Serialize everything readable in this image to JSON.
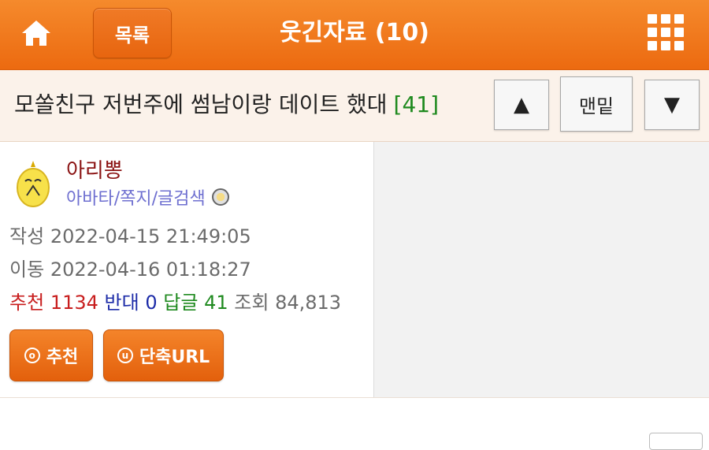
{
  "header": {
    "list_label": "목록",
    "title": "웃긴자료 (10)",
    "icons": [
      "home-icon",
      "grid-menu-icon"
    ],
    "accent_color": "#ee7418"
  },
  "post": {
    "title": "모쏠친구 저번주에 썸남이랑 데이트 했대",
    "comment_count": "[41]"
  },
  "nav": {
    "up_icon": "▲",
    "bottom_label": "맨밑",
    "down_icon": "▼"
  },
  "author": {
    "nickname": "아리뽕",
    "links": "아바타/쪽지/글검색"
  },
  "meta": {
    "written_label": "작성",
    "written_at": "2022-04-15 21:49:05",
    "moved_label": "이동",
    "moved_at": "2022-04-16 01:18:27"
  },
  "stats": {
    "recommend_label": "추천",
    "recommend": "1134",
    "oppose_label": "반대",
    "oppose": "0",
    "reply_label": "답글",
    "reply": "41",
    "views_label": "조회",
    "views": "84,813"
  },
  "actions": {
    "recommend_icon": "o",
    "recommend_label": "추천",
    "shorturl_icon": "u",
    "shorturl_label": "단축URL"
  }
}
